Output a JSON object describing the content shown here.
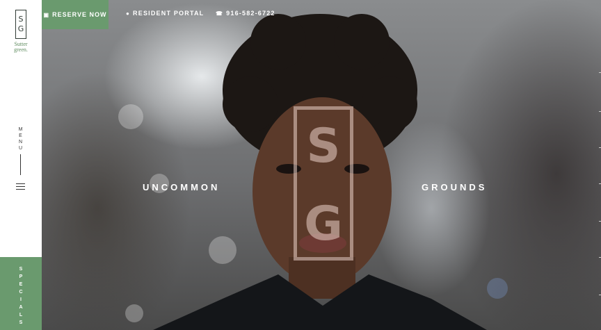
{
  "brand": {
    "monogram_top": "S",
    "monogram_bottom": "G",
    "name_line1": "Sutter",
    "name_line2": "green."
  },
  "sidebar": {
    "menu_label": "MENU",
    "hamburger_icon": "hamburger-icon",
    "specials_label": "SPECIALS"
  },
  "header": {
    "reserve": {
      "icon": "calendar-icon",
      "label": "RESERVE NOW"
    },
    "resident_portal": {
      "icon": "user-icon",
      "label": "RESIDENT PORTAL"
    },
    "phone": {
      "icon": "phone-icon",
      "label": "916-582-6722"
    }
  },
  "hero": {
    "tagline_left": "UNCOMMON",
    "tagline_right": "GROUNDS",
    "mark_top": "S",
    "mark_bottom": "G"
  },
  "colors": {
    "accent_green": "#6a9a6e",
    "sidebar_bg": "#ffffff"
  }
}
